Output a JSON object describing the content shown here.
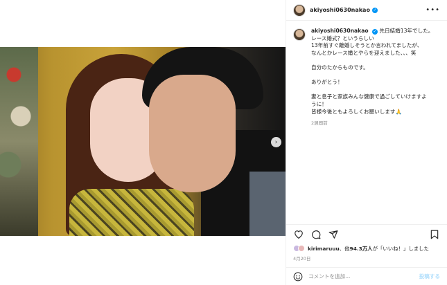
{
  "post": {
    "username": "akiyoshi0630nakao",
    "more_label": "•••"
  },
  "caption": {
    "username": "akiyoshi0630nakao",
    "lines": [
      "先日結婚13年でした。",
      "レース婚式？というらしい",
      "13年前すぐ離婚しそうとか言われてましたが、",
      "なんとかレース婚とやらを迎えました、、、笑",
      "",
      "自分のたからものです。",
      "",
      "ありがとう！",
      "",
      "妻と息子と家族みんな健康で過ごしていけますよ",
      "うに！",
      "皆様今後ともよろしくお願いします🙏"
    ],
    "time_ago": "2週間前"
  },
  "likes": {
    "user": "kirimaruuu",
    "text_mid": "、他",
    "count": "94.3万人",
    "text_end": "が「いいね！」しました"
  },
  "date": "4月20日",
  "comment": {
    "placeholder": "コメントを追加...",
    "post_label": "投稿する"
  },
  "icons": {
    "heart": "heart-icon",
    "comment": "comment-icon",
    "share": "share-icon",
    "bookmark": "bookmark-icon",
    "emoji": "emoji-icon",
    "next": "chevron-right-icon"
  },
  "colors": {
    "verified": "#0095f6",
    "post_button": "#b2dffc",
    "secondary_text": "#8e8e8e"
  }
}
